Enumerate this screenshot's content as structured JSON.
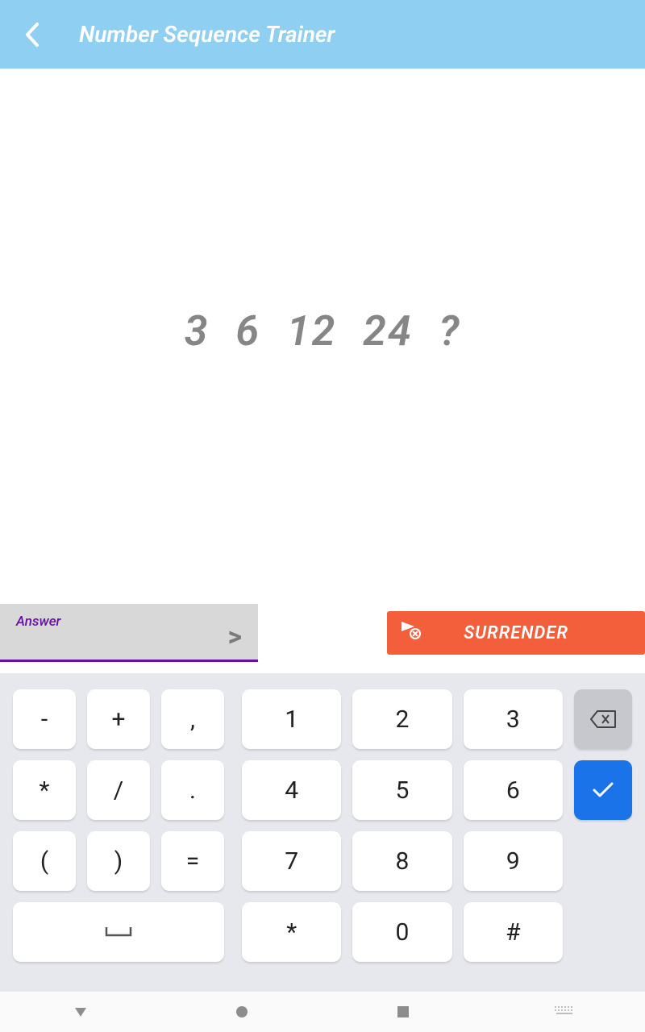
{
  "header": {
    "title": "Number Sequence Trainer"
  },
  "sequence": "3  6  12  24  ?",
  "answer": {
    "label": "Answer",
    "value": ""
  },
  "surrender": {
    "label": "SURRENDER"
  },
  "keypad_left": {
    "r1": [
      "-",
      "+",
      ","
    ],
    "r2": [
      "*",
      "/",
      "."
    ],
    "r3": [
      "(",
      ")",
      "="
    ],
    "space": "␣"
  },
  "keypad_right": {
    "r1": [
      "1",
      "2",
      "3"
    ],
    "r2": [
      "4",
      "5",
      "6"
    ],
    "r3": [
      "7",
      "8",
      "9"
    ],
    "r4": [
      "*",
      "0",
      "#"
    ]
  }
}
